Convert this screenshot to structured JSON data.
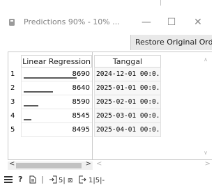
{
  "window": {
    "title": "Predictions  90% - 10%  ...",
    "minimize": "—",
    "maximize": "☐",
    "close": "✕"
  },
  "restore_button": "Restore Original Order",
  "table": {
    "left_header": "Linear Regression",
    "right_header": "Tanggal",
    "rows": [
      {
        "index": "1",
        "value": "8690",
        "date": "2024-12-01 00:0..."
      },
      {
        "index": "2",
        "value": "8640",
        "date": "2025-01-01 00:0..."
      },
      {
        "index": "3",
        "value": "8590",
        "date": "2025-02-01 00:0..."
      },
      {
        "index": "4",
        "value": "8545",
        "date": "2025-03-01 00:0..."
      },
      {
        "index": "5",
        "value": "8495",
        "date": "2025-04-01 00:0..."
      }
    ],
    "bar_fractions": [
      1.0,
      0.55,
      0.27,
      0.14,
      0.0
    ]
  },
  "status": {
    "left_counts": "5|",
    "right_counts": "1|5|-"
  },
  "icons": {
    "menu": "hamburger-icon",
    "help": "help-icon",
    "report": "report-icon",
    "input": "input-icon",
    "output": "output-icon"
  }
}
